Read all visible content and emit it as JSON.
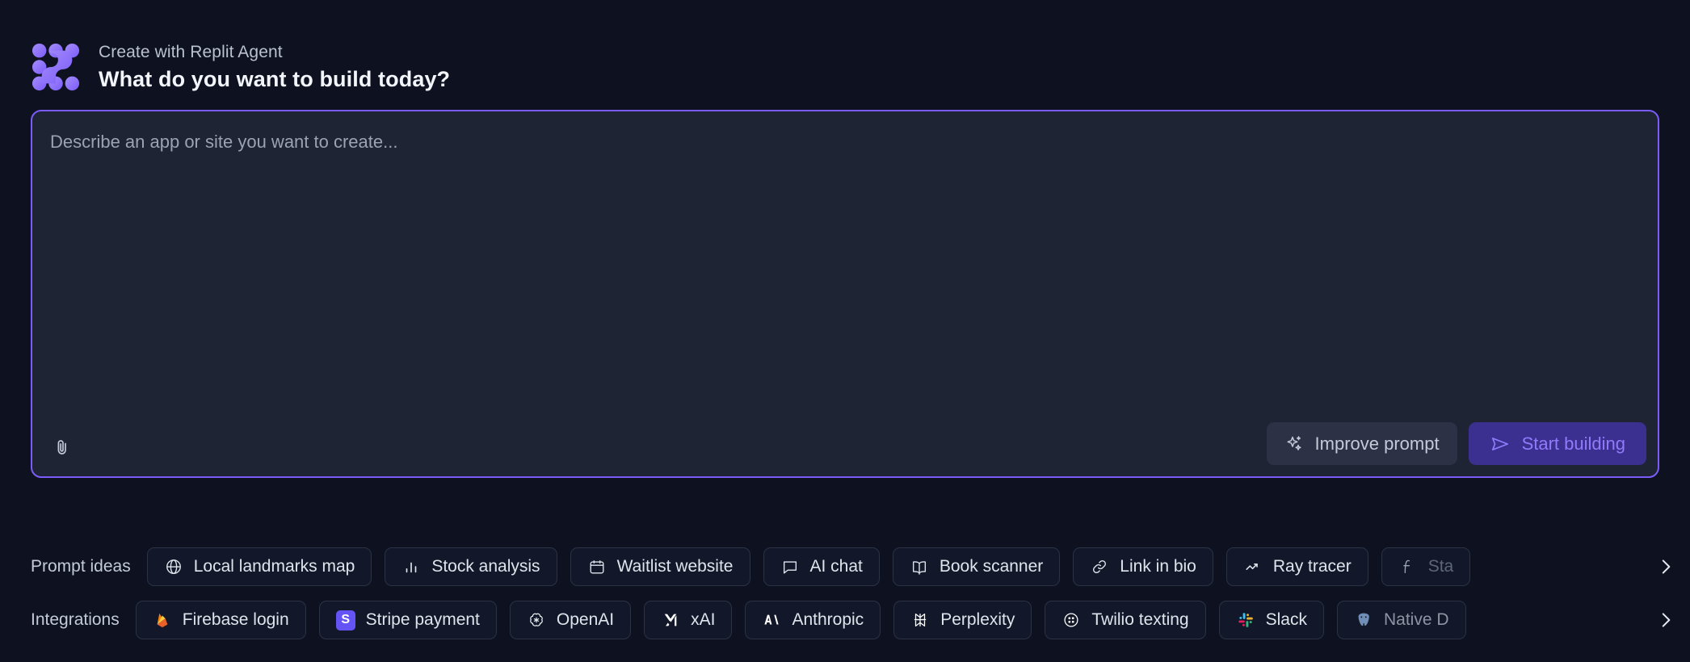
{
  "header": {
    "eyebrow": "Create with Replit Agent",
    "headline": "What do you want to build today?",
    "logo_icon": "replit-logo-icon"
  },
  "composer": {
    "placeholder": "Describe an app or site you want to create...",
    "value": "",
    "attach_icon": "paperclip-icon",
    "improve_label": "Improve prompt",
    "improve_icon": "sparkles-icon",
    "start_label": "Start building",
    "start_icon": "send-icon",
    "border_color": "#7b5cfa",
    "start_bg": "#3b2f8f",
    "start_fg": "#8f7bfb"
  },
  "prompt_ideas": {
    "label": "Prompt ideas",
    "scroll_icon": "chevron-right-icon",
    "items": [
      {
        "label": "Local landmarks map",
        "icon": "globe-icon"
      },
      {
        "label": "Stock analysis",
        "icon": "bar-chart-icon"
      },
      {
        "label": "Waitlist website",
        "icon": "calendar-icon"
      },
      {
        "label": "AI chat",
        "icon": "message-square-icon"
      },
      {
        "label": "Book scanner",
        "icon": "book-open-icon"
      },
      {
        "label": "Link in bio",
        "icon": "link-icon"
      },
      {
        "label": "Ray tracer",
        "icon": "trending-up-icon"
      },
      {
        "label": "Sta",
        "icon": "function-icon"
      }
    ]
  },
  "integrations": {
    "label": "Integrations",
    "scroll_icon": "chevron-right-icon",
    "items": [
      {
        "label": "Firebase login",
        "icon": "firebase-icon"
      },
      {
        "label": "Stripe payment",
        "icon": "stripe-icon"
      },
      {
        "label": "OpenAI",
        "icon": "openai-icon"
      },
      {
        "label": "xAI",
        "icon": "xai-icon"
      },
      {
        "label": "Anthropic",
        "icon": "anthropic-icon"
      },
      {
        "label": "Perplexity",
        "icon": "perplexity-icon"
      },
      {
        "label": "Twilio texting",
        "icon": "twilio-icon"
      },
      {
        "label": "Slack",
        "icon": "slack-icon"
      },
      {
        "label": "Native D",
        "icon": "postgresql-icon"
      }
    ]
  },
  "colors": {
    "page_bg": "#0e1220",
    "composer_bg": "#1e2434",
    "accent": "#7b5cfa",
    "chip_bg": "#121829",
    "chip_border": "#2a3244"
  }
}
